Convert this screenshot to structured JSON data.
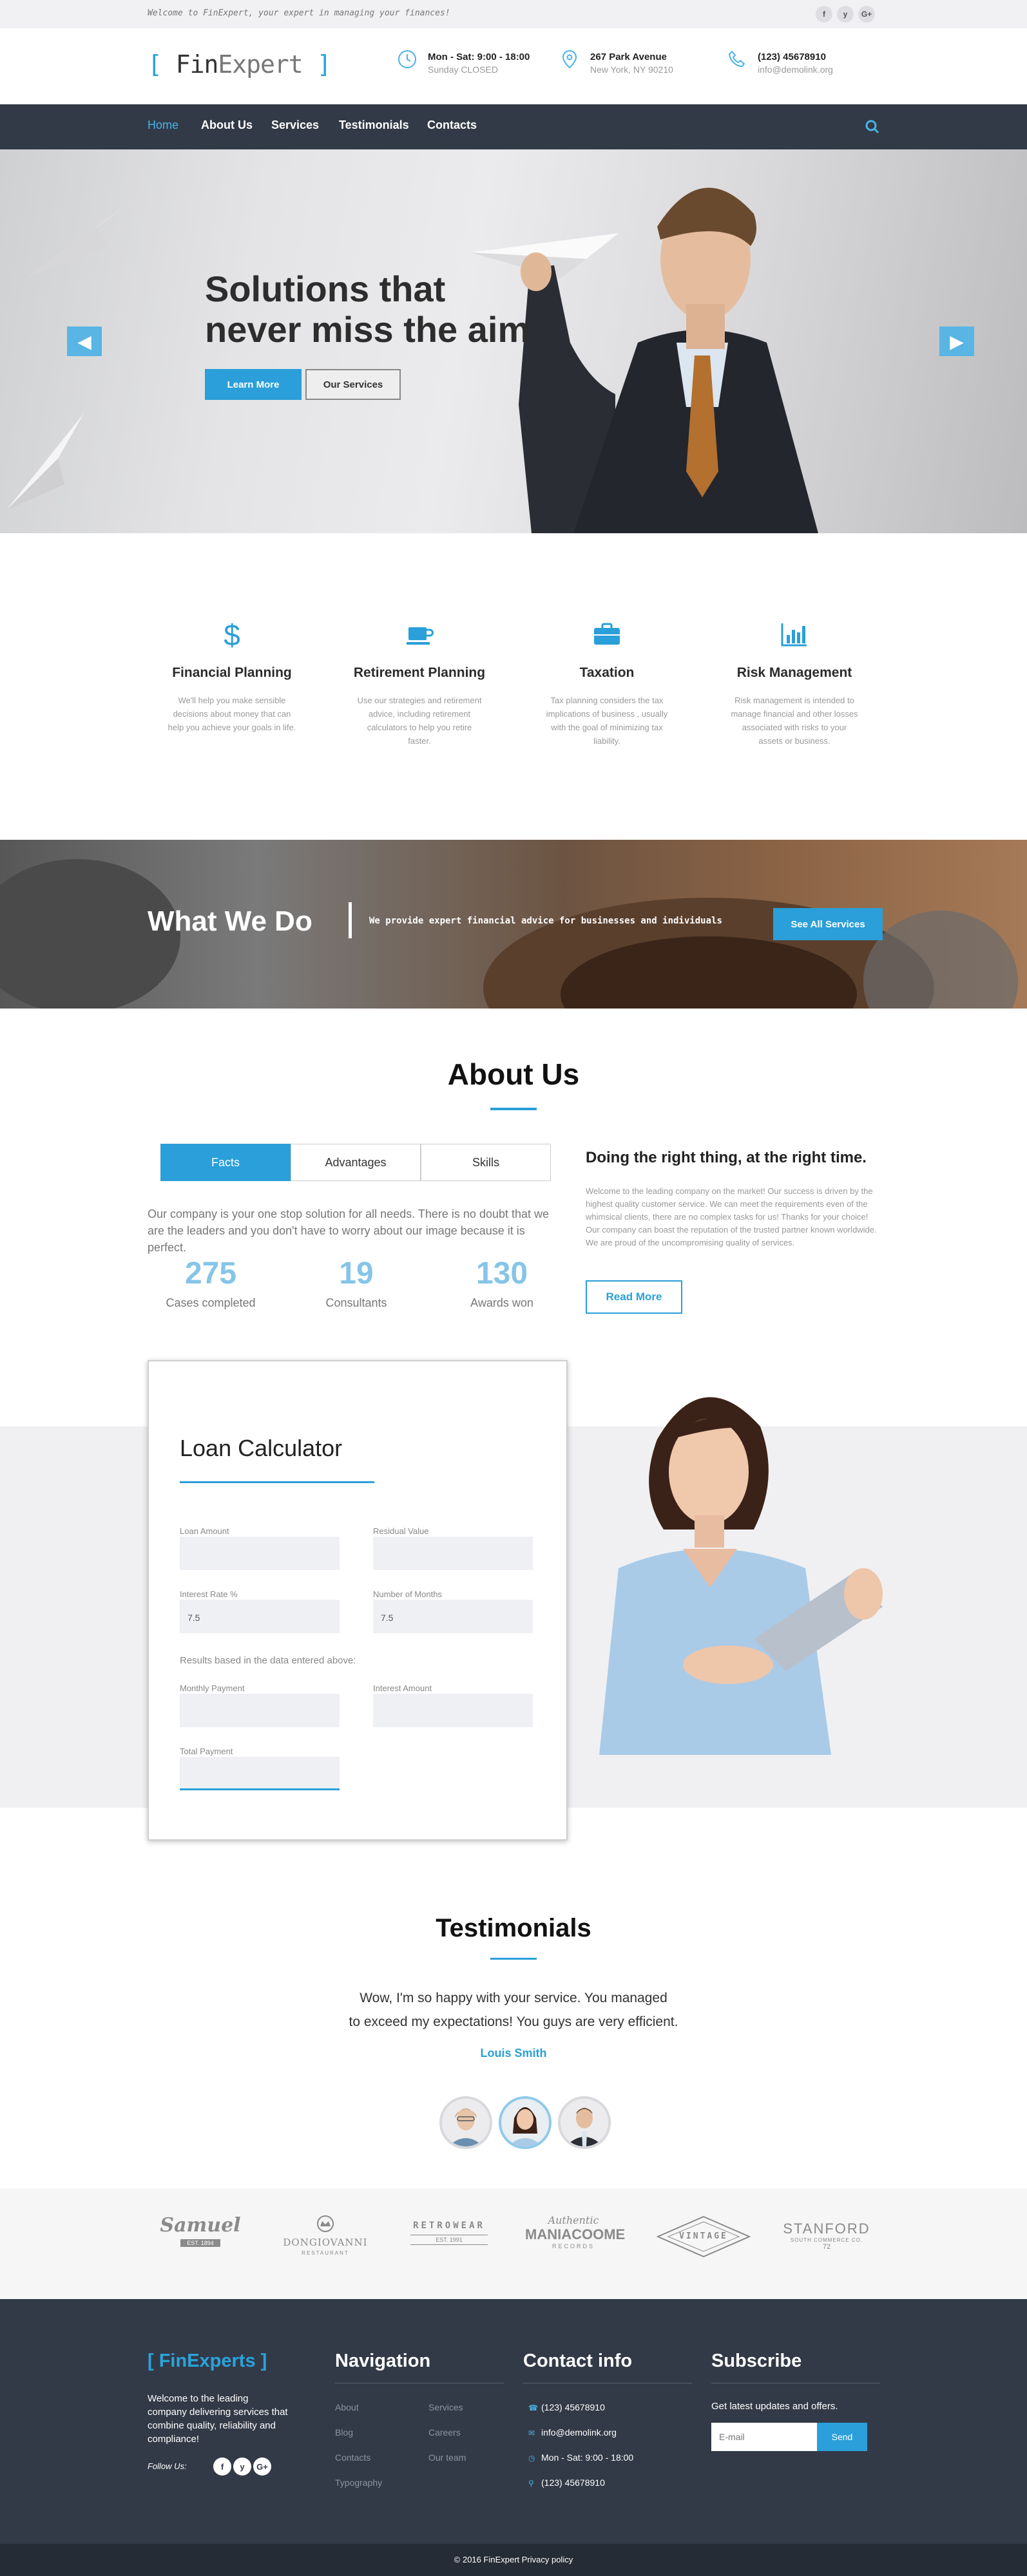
{
  "topbar": {
    "tagline": "Welcome to FinExpert, your expert in managing your finances!",
    "social": [
      {
        "label": "f",
        "icon": "facebook-icon"
      },
      {
        "label": "y",
        "icon": "twitter-icon"
      },
      {
        "label": "G+",
        "icon": "google-plus-icon"
      }
    ]
  },
  "header": {
    "logo": {
      "left": "[ ",
      "fin": "Fin",
      "expert": "Expert",
      "right": " ]"
    },
    "hours": {
      "line1": "Mon - Sat: 9:00 - 18:00",
      "line2": "Sunday CLOSED",
      "icon": "clock-icon"
    },
    "address": {
      "line1": "267 Park Avenue",
      "line2": "New York, NY 90210",
      "icon": "map-pin-icon"
    },
    "contact": {
      "line1": "(123) 45678910",
      "line2": "info@demolink.org",
      "icon": "phone-icon"
    }
  },
  "nav": {
    "items": [
      "Home",
      "About Us",
      "Services",
      "Testimonials",
      "Contacts"
    ],
    "active": "Home",
    "search_icon": "search-icon"
  },
  "hero": {
    "title_line1": "Solutions that",
    "title_line2": "never miss the aim",
    "learn_more": "Learn More",
    "our_services": "Our Services"
  },
  "features": [
    {
      "icon": "dollar-icon",
      "title": "Financial Planning",
      "text": "We'll help you make sensible decisions about money that can help you achieve your goals in life."
    },
    {
      "icon": "coffee-cup-icon",
      "title": "Retirement Planning",
      "text": "Use our strategies and retirement advice, including retirement calculators to help you retire faster."
    },
    {
      "icon": "briefcase-icon",
      "title": "Taxation",
      "text": "Tax planning considers the tax implications of business , usually with the goal of minimizing tax liability."
    },
    {
      "icon": "bar-chart-icon",
      "title": "Risk Management",
      "text": "Risk management is intended to manage financial and other losses associated with risks to your assets or business."
    }
  ],
  "what_we_do": {
    "title": "What We Do",
    "text": "We provide expert financial advice for businesses and individuals",
    "button": "See All Services"
  },
  "about": {
    "title": "About Us",
    "tabs": [
      "Facts",
      "Advantages",
      "Skills"
    ],
    "active_tab": "Facts",
    "intro": "Our company is your one stop solution for all needs. There is no doubt that we are the leaders and you don't have to worry about our image because it is perfect.",
    "stats": [
      {
        "value": "275",
        "label": "Cases completed"
      },
      {
        "value": "19",
        "label": "Consultants"
      },
      {
        "value": "130",
        "label": "Awards won"
      }
    ],
    "right_heading": "Doing the right thing, at the right time.",
    "right_text": "Welcome to the leading company on the market! Our success is driven by the highest quality customer service. We can meet the requirements even of the whimsical clients, there are no complex tasks for us! Thanks for your choice! Our company can boast the reputation of the trusted partner known worldwide. We are proud of the uncompromising quality of services.",
    "read_more": "Read More"
  },
  "calculator": {
    "title": "Loan Calculator",
    "fields": {
      "loan_amount": {
        "label": "Loan Amount",
        "value": ""
      },
      "residual_value": {
        "label": "Residual Value",
        "value": ""
      },
      "interest_rate": {
        "label": "Interest Rate %",
        "value": "7.5"
      },
      "months": {
        "label": "Number of Months",
        "value": "7.5"
      }
    },
    "results_label": "Results based in the data entered above:",
    "results": {
      "monthly_payment": {
        "label": "Monthly Payment",
        "value": ""
      },
      "interest_amount": {
        "label": "Interest Amount",
        "value": ""
      },
      "total_payment": {
        "label": "Total Payment",
        "value": ""
      }
    }
  },
  "testimonials": {
    "title": "Testimonials",
    "quote_line1": "Wow, I'm so happy with your service. You managed",
    "quote_line2": "to exceed my expectations! You guys are very efficient.",
    "author": "Louis Smith",
    "avatars": [
      "avatar-woman-glasses",
      "avatar-woman",
      "avatar-man"
    ]
  },
  "brands": [
    {
      "name": "Samuel",
      "sub": "EST. 1894"
    },
    {
      "name": "DONGIOVANNI",
      "sub": "RESTAURANT"
    },
    {
      "name": "RETROWEAR",
      "sub": "EST. 1991"
    },
    {
      "name": "MANIACOOME",
      "sub": "RECORDS",
      "top": "Authentic"
    },
    {
      "name": "VINTAGE",
      "sub": ""
    },
    {
      "name": "STANFORD",
      "sub": "SOUTH COMMERCE CO.",
      "num": "72"
    }
  ],
  "footer": {
    "brand": "[ FinExperts ]",
    "about_text": "Welcome to the leading company delivering services that combine quality, reliability and compliance!",
    "follow_label": "Follow Us:",
    "social": [
      {
        "label": "f",
        "icon": "facebook-icon"
      },
      {
        "label": "y",
        "icon": "twitter-icon"
      },
      {
        "label": "G+",
        "icon": "google-plus-icon"
      }
    ],
    "navigation_title": "Navigation",
    "nav_col1": [
      "About",
      "Blog",
      "Contacts",
      "Typography"
    ],
    "nav_col2": [
      "Services",
      "Careers",
      "Our team"
    ],
    "contact_title": "Contact info",
    "contact_items": [
      {
        "icon": "phone-icon",
        "text": "(123) 45678910"
      },
      {
        "icon": "mail-icon",
        "text": "info@demolink.org"
      },
      {
        "icon": "clock-icon",
        "text": "Mon - Sat: 9:00 - 18:00"
      },
      {
        "icon": "map-pin-icon",
        "text": "(123) 45678910"
      }
    ],
    "subscribe_title": "Subscribe",
    "subscribe_text": "Get latest updates and offers.",
    "email_placeholder": "E-mail",
    "send": "Send",
    "copyright": "© 2016 FinExpert Privacy policy"
  }
}
